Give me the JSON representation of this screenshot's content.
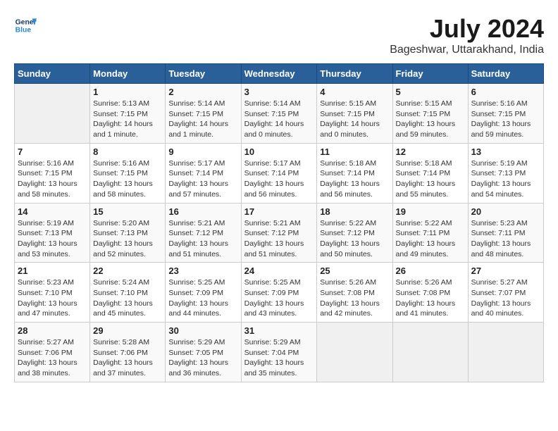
{
  "header": {
    "logo_line1": "General",
    "logo_line2": "Blue",
    "month_year": "July 2024",
    "location": "Bageshwar, Uttarakhand, India"
  },
  "days_of_week": [
    "Sunday",
    "Monday",
    "Tuesday",
    "Wednesday",
    "Thursday",
    "Friday",
    "Saturday"
  ],
  "weeks": [
    [
      {
        "day": "",
        "info": ""
      },
      {
        "day": "1",
        "info": "Sunrise: 5:13 AM\nSunset: 7:15 PM\nDaylight: 14 hours\nand 1 minute."
      },
      {
        "day": "2",
        "info": "Sunrise: 5:14 AM\nSunset: 7:15 PM\nDaylight: 14 hours\nand 1 minute."
      },
      {
        "day": "3",
        "info": "Sunrise: 5:14 AM\nSunset: 7:15 PM\nDaylight: 14 hours\nand 0 minutes."
      },
      {
        "day": "4",
        "info": "Sunrise: 5:15 AM\nSunset: 7:15 PM\nDaylight: 14 hours\nand 0 minutes."
      },
      {
        "day": "5",
        "info": "Sunrise: 5:15 AM\nSunset: 7:15 PM\nDaylight: 13 hours\nand 59 minutes."
      },
      {
        "day": "6",
        "info": "Sunrise: 5:16 AM\nSunset: 7:15 PM\nDaylight: 13 hours\nand 59 minutes."
      }
    ],
    [
      {
        "day": "7",
        "info": "Sunrise: 5:16 AM\nSunset: 7:15 PM\nDaylight: 13 hours\nand 58 minutes."
      },
      {
        "day": "8",
        "info": "Sunrise: 5:16 AM\nSunset: 7:15 PM\nDaylight: 13 hours\nand 58 minutes."
      },
      {
        "day": "9",
        "info": "Sunrise: 5:17 AM\nSunset: 7:14 PM\nDaylight: 13 hours\nand 57 minutes."
      },
      {
        "day": "10",
        "info": "Sunrise: 5:17 AM\nSunset: 7:14 PM\nDaylight: 13 hours\nand 56 minutes."
      },
      {
        "day": "11",
        "info": "Sunrise: 5:18 AM\nSunset: 7:14 PM\nDaylight: 13 hours\nand 56 minutes."
      },
      {
        "day": "12",
        "info": "Sunrise: 5:18 AM\nSunset: 7:14 PM\nDaylight: 13 hours\nand 55 minutes."
      },
      {
        "day": "13",
        "info": "Sunrise: 5:19 AM\nSunset: 7:13 PM\nDaylight: 13 hours\nand 54 minutes."
      }
    ],
    [
      {
        "day": "14",
        "info": "Sunrise: 5:19 AM\nSunset: 7:13 PM\nDaylight: 13 hours\nand 53 minutes."
      },
      {
        "day": "15",
        "info": "Sunrise: 5:20 AM\nSunset: 7:13 PM\nDaylight: 13 hours\nand 52 minutes."
      },
      {
        "day": "16",
        "info": "Sunrise: 5:21 AM\nSunset: 7:12 PM\nDaylight: 13 hours\nand 51 minutes."
      },
      {
        "day": "17",
        "info": "Sunrise: 5:21 AM\nSunset: 7:12 PM\nDaylight: 13 hours\nand 51 minutes."
      },
      {
        "day": "18",
        "info": "Sunrise: 5:22 AM\nSunset: 7:12 PM\nDaylight: 13 hours\nand 50 minutes."
      },
      {
        "day": "19",
        "info": "Sunrise: 5:22 AM\nSunset: 7:11 PM\nDaylight: 13 hours\nand 49 minutes."
      },
      {
        "day": "20",
        "info": "Sunrise: 5:23 AM\nSunset: 7:11 PM\nDaylight: 13 hours\nand 48 minutes."
      }
    ],
    [
      {
        "day": "21",
        "info": "Sunrise: 5:23 AM\nSunset: 7:10 PM\nDaylight: 13 hours\nand 47 minutes."
      },
      {
        "day": "22",
        "info": "Sunrise: 5:24 AM\nSunset: 7:10 PM\nDaylight: 13 hours\nand 45 minutes."
      },
      {
        "day": "23",
        "info": "Sunrise: 5:25 AM\nSunset: 7:09 PM\nDaylight: 13 hours\nand 44 minutes."
      },
      {
        "day": "24",
        "info": "Sunrise: 5:25 AM\nSunset: 7:09 PM\nDaylight: 13 hours\nand 43 minutes."
      },
      {
        "day": "25",
        "info": "Sunrise: 5:26 AM\nSunset: 7:08 PM\nDaylight: 13 hours\nand 42 minutes."
      },
      {
        "day": "26",
        "info": "Sunrise: 5:26 AM\nSunset: 7:08 PM\nDaylight: 13 hours\nand 41 minutes."
      },
      {
        "day": "27",
        "info": "Sunrise: 5:27 AM\nSunset: 7:07 PM\nDaylight: 13 hours\nand 40 minutes."
      }
    ],
    [
      {
        "day": "28",
        "info": "Sunrise: 5:27 AM\nSunset: 7:06 PM\nDaylight: 13 hours\nand 38 minutes."
      },
      {
        "day": "29",
        "info": "Sunrise: 5:28 AM\nSunset: 7:06 PM\nDaylight: 13 hours\nand 37 minutes."
      },
      {
        "day": "30",
        "info": "Sunrise: 5:29 AM\nSunset: 7:05 PM\nDaylight: 13 hours\nand 36 minutes."
      },
      {
        "day": "31",
        "info": "Sunrise: 5:29 AM\nSunset: 7:04 PM\nDaylight: 13 hours\nand 35 minutes."
      },
      {
        "day": "",
        "info": ""
      },
      {
        "day": "",
        "info": ""
      },
      {
        "day": "",
        "info": ""
      }
    ]
  ]
}
